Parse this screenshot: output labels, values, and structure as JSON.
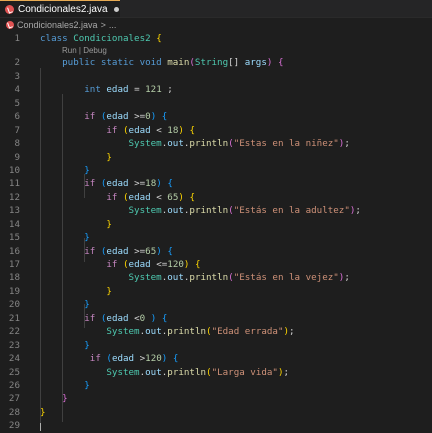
{
  "tab": {
    "filename": "Condicionales2.java"
  },
  "breadcrumb": {
    "file": "Condicionales2.java",
    "separator": ">",
    "more": "..."
  },
  "codelens": {
    "text": "Run | Debug"
  },
  "lines": [
    {
      "n": "1",
      "tokens": [
        {
          "t": "class ",
          "c": "kw"
        },
        {
          "t": "Condicionales2",
          "c": "ty"
        },
        {
          "t": " ",
          "c": "pl"
        },
        {
          "t": "{",
          "c": "b1"
        }
      ]
    },
    {
      "n": "2",
      "tokens": [
        {
          "t": "    public static void ",
          "c": "kw"
        },
        {
          "t": "main",
          "c": "fn"
        },
        {
          "t": "(",
          "c": "b2"
        },
        {
          "t": "String",
          "c": "ty"
        },
        {
          "t": "[] ",
          "c": "pl"
        },
        {
          "t": "args",
          "c": "vr"
        },
        {
          "t": ")",
          "c": "b2"
        },
        {
          "t": " ",
          "c": "pl"
        },
        {
          "t": "{",
          "c": "b2"
        }
      ]
    },
    {
      "n": "3",
      "tokens": []
    },
    {
      "n": "4",
      "tokens": [
        {
          "t": "        int ",
          "c": "kw"
        },
        {
          "t": "edad",
          "c": "vr"
        },
        {
          "t": " = ",
          "c": "pl"
        },
        {
          "t": "121",
          "c": "nm"
        },
        {
          "t": " ;",
          "c": "pl"
        }
      ]
    },
    {
      "n": "5",
      "tokens": []
    },
    {
      "n": "6",
      "tokens": [
        {
          "t": "        if ",
          "c": "kc"
        },
        {
          "t": "(",
          "c": "b3"
        },
        {
          "t": "edad",
          "c": "vr"
        },
        {
          "t": " >=",
          "c": "pl"
        },
        {
          "t": "0",
          "c": "nm"
        },
        {
          "t": ")",
          "c": "b3"
        },
        {
          "t": " ",
          "c": "pl"
        },
        {
          "t": "{",
          "c": "b3"
        }
      ]
    },
    {
      "n": "7",
      "tokens": [
        {
          "t": "            if ",
          "c": "kc"
        },
        {
          "t": "(",
          "c": "b1"
        },
        {
          "t": "edad",
          "c": "vr"
        },
        {
          "t": " < ",
          "c": "pl"
        },
        {
          "t": "18",
          "c": "nm"
        },
        {
          "t": ")",
          "c": "b1"
        },
        {
          "t": " ",
          "c": "pl"
        },
        {
          "t": "{",
          "c": "b1"
        }
      ]
    },
    {
      "n": "8",
      "tokens": [
        {
          "t": "                System",
          "c": "ty"
        },
        {
          "t": ".",
          "c": "pl"
        },
        {
          "t": "out",
          "c": "vr"
        },
        {
          "t": ".",
          "c": "pl"
        },
        {
          "t": "println",
          "c": "fn"
        },
        {
          "t": "(",
          "c": "b2"
        },
        {
          "t": "\"Estas en la niñez\"",
          "c": "st"
        },
        {
          "t": ")",
          "c": "b2"
        },
        {
          "t": ";",
          "c": "pl"
        }
      ]
    },
    {
      "n": "9",
      "tokens": [
        {
          "t": "            }",
          "c": "b1"
        }
      ]
    },
    {
      "n": "10",
      "tokens": [
        {
          "t": "        }",
          "c": "b3"
        }
      ]
    },
    {
      "n": "11",
      "tokens": [
        {
          "t": "        if ",
          "c": "kc"
        },
        {
          "t": "(",
          "c": "b3"
        },
        {
          "t": "edad",
          "c": "vr"
        },
        {
          "t": " >=",
          "c": "pl"
        },
        {
          "t": "18",
          "c": "nm"
        },
        {
          "t": ")",
          "c": "b3"
        },
        {
          "t": " ",
          "c": "pl"
        },
        {
          "t": "{",
          "c": "b3"
        }
      ]
    },
    {
      "n": "12",
      "tokens": [
        {
          "t": "            if ",
          "c": "kc"
        },
        {
          "t": "(",
          "c": "b1"
        },
        {
          "t": "edad",
          "c": "vr"
        },
        {
          "t": " < ",
          "c": "pl"
        },
        {
          "t": "65",
          "c": "nm"
        },
        {
          "t": ")",
          "c": "b1"
        },
        {
          "t": " ",
          "c": "pl"
        },
        {
          "t": "{",
          "c": "b1"
        }
      ]
    },
    {
      "n": "13",
      "tokens": [
        {
          "t": "                System",
          "c": "ty"
        },
        {
          "t": ".",
          "c": "pl"
        },
        {
          "t": "out",
          "c": "vr"
        },
        {
          "t": ".",
          "c": "pl"
        },
        {
          "t": "println",
          "c": "fn"
        },
        {
          "t": "(",
          "c": "b2"
        },
        {
          "t": "\"Estás en la adultez\"",
          "c": "st"
        },
        {
          "t": ")",
          "c": "b2"
        },
        {
          "t": ";",
          "c": "pl"
        }
      ]
    },
    {
      "n": "14",
      "tokens": [
        {
          "t": "            }",
          "c": "b1"
        }
      ]
    },
    {
      "n": "15",
      "tokens": [
        {
          "t": "        }",
          "c": "b3"
        }
      ]
    },
    {
      "n": "16",
      "tokens": [
        {
          "t": "        if ",
          "c": "kc"
        },
        {
          "t": "(",
          "c": "b3"
        },
        {
          "t": "edad",
          "c": "vr"
        },
        {
          "t": " >=",
          "c": "pl"
        },
        {
          "t": "65",
          "c": "nm"
        },
        {
          "t": ")",
          "c": "b3"
        },
        {
          "t": " ",
          "c": "pl"
        },
        {
          "t": "{",
          "c": "b3"
        }
      ]
    },
    {
      "n": "17",
      "tokens": [
        {
          "t": "            if ",
          "c": "kc"
        },
        {
          "t": "(",
          "c": "b1"
        },
        {
          "t": "edad",
          "c": "vr"
        },
        {
          "t": " <=",
          "c": "pl"
        },
        {
          "t": "120",
          "c": "nm"
        },
        {
          "t": ")",
          "c": "b1"
        },
        {
          "t": " ",
          "c": "pl"
        },
        {
          "t": "{",
          "c": "b1"
        }
      ]
    },
    {
      "n": "18",
      "tokens": [
        {
          "t": "                System",
          "c": "ty"
        },
        {
          "t": ".",
          "c": "pl"
        },
        {
          "t": "out",
          "c": "vr"
        },
        {
          "t": ".",
          "c": "pl"
        },
        {
          "t": "println",
          "c": "fn"
        },
        {
          "t": "(",
          "c": "b2"
        },
        {
          "t": "\"Estás en la vejez\"",
          "c": "st"
        },
        {
          "t": ")",
          "c": "b2"
        },
        {
          "t": ";",
          "c": "pl"
        }
      ]
    },
    {
      "n": "19",
      "tokens": [
        {
          "t": "            }",
          "c": "b1"
        }
      ]
    },
    {
      "n": "20",
      "tokens": [
        {
          "t": "        }",
          "c": "b3"
        }
      ]
    },
    {
      "n": "21",
      "tokens": [
        {
          "t": "        if ",
          "c": "kc"
        },
        {
          "t": "(",
          "c": "b3"
        },
        {
          "t": "edad",
          "c": "vr"
        },
        {
          "t": " <",
          "c": "pl"
        },
        {
          "t": "0",
          "c": "nm"
        },
        {
          "t": " ",
          "c": "pl"
        },
        {
          "t": ")",
          "c": "b3"
        },
        {
          "t": " ",
          "c": "pl"
        },
        {
          "t": "{",
          "c": "b3"
        }
      ]
    },
    {
      "n": "22",
      "tokens": [
        {
          "t": "            System",
          "c": "ty"
        },
        {
          "t": ".",
          "c": "pl"
        },
        {
          "t": "out",
          "c": "vr"
        },
        {
          "t": ".",
          "c": "pl"
        },
        {
          "t": "println",
          "c": "fn"
        },
        {
          "t": "(",
          "c": "b1"
        },
        {
          "t": "\"Edad errada\"",
          "c": "st"
        },
        {
          "t": ")",
          "c": "b1"
        },
        {
          "t": ";",
          "c": "pl"
        }
      ]
    },
    {
      "n": "23",
      "tokens": [
        {
          "t": "        }",
          "c": "b3"
        }
      ]
    },
    {
      "n": "24",
      "tokens": [
        {
          "t": "         if ",
          "c": "kc"
        },
        {
          "t": "(",
          "c": "b3"
        },
        {
          "t": "edad",
          "c": "vr"
        },
        {
          "t": " >",
          "c": "pl"
        },
        {
          "t": "120",
          "c": "nm"
        },
        {
          "t": ")",
          "c": "b3"
        },
        {
          "t": " ",
          "c": "pl"
        },
        {
          "t": "{",
          "c": "b3"
        }
      ]
    },
    {
      "n": "25",
      "tokens": [
        {
          "t": "            System",
          "c": "ty"
        },
        {
          "t": ".",
          "c": "pl"
        },
        {
          "t": "out",
          "c": "vr"
        },
        {
          "t": ".",
          "c": "pl"
        },
        {
          "t": "println",
          "c": "fn"
        },
        {
          "t": "(",
          "c": "b1"
        },
        {
          "t": "\"Larga vida\"",
          "c": "st"
        },
        {
          "t": ")",
          "c": "b1"
        },
        {
          "t": ";",
          "c": "pl"
        }
      ]
    },
    {
      "n": "26",
      "tokens": [
        {
          "t": "        }",
          "c": "b3"
        }
      ]
    },
    {
      "n": "27",
      "tokens": [
        {
          "t": "    }",
          "c": "b2"
        }
      ]
    },
    {
      "n": "28",
      "tokens": [
        {
          "t": "}",
          "c": "b1"
        }
      ]
    },
    {
      "n": "29",
      "tokens": []
    }
  ]
}
